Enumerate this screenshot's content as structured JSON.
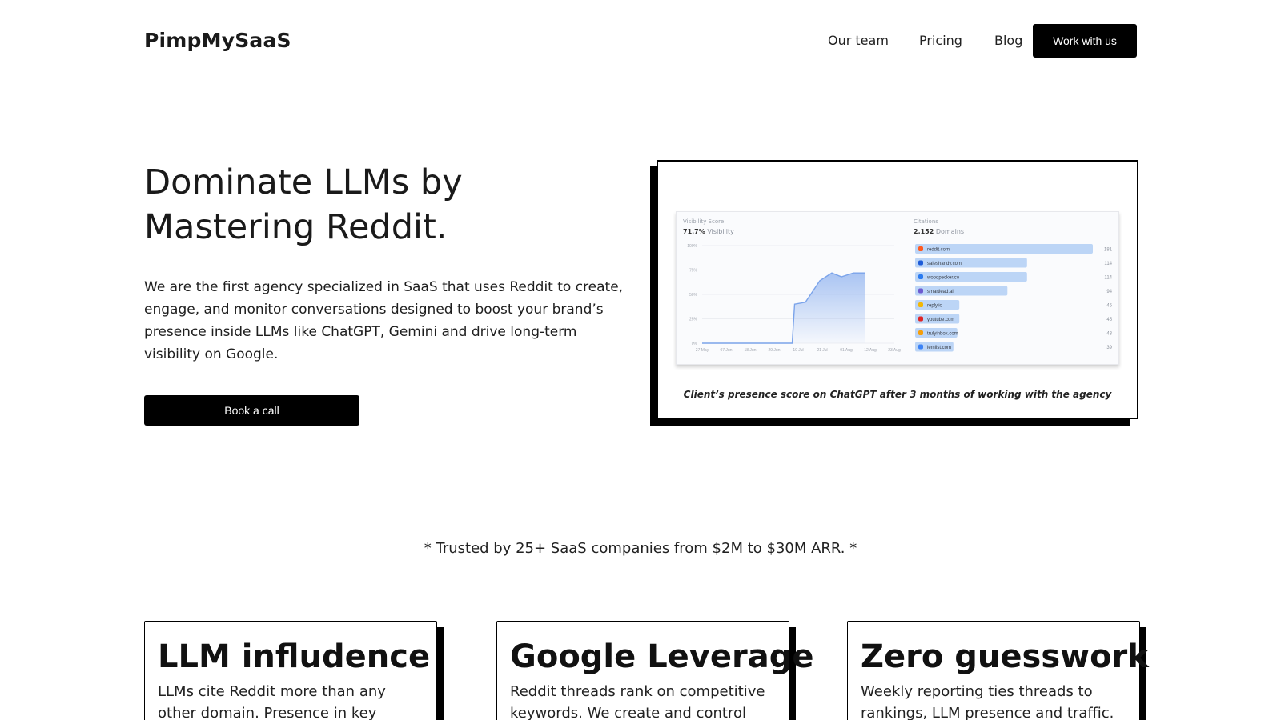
{
  "nav": {
    "brand": "PimpMySaaS",
    "links": [
      "Our team",
      "Pricing",
      "Blog"
    ],
    "cta": "Work with us"
  },
  "hero": {
    "title": "Dominate LLMs by Mastering Reddit.",
    "subtitle": "We are the first agency specialized in SaaS that uses Reddit to create, engage, and monitor conversations designed to boost your brand’s presence inside LLMs like ChatGPT, Gemini and drive long-term visibility on Google.",
    "cta": "Book a call"
  },
  "screenshot": {
    "caption": "Client’s presence score on ChatGPT after 3 months of working with the agency",
    "visibility": {
      "label": "Visibility Score",
      "value": "71.7%",
      "value_suffix": "Visibility"
    },
    "citations": {
      "label": "Citations",
      "value": "2,152",
      "value_suffix": "Domains"
    }
  },
  "chart_data": [
    {
      "type": "area",
      "title": "Visibility Score",
      "x": [
        "27 May",
        "07 Jun",
        "18 Jun",
        "29 Jun",
        "10 Jul",
        "21 Jul",
        "01 Aug",
        "12 Aug",
        "23 Aug"
      ],
      "y_ticks": [
        "0%",
        "25%",
        "50%",
        "75%",
        "100%"
      ],
      "ylim": [
        0,
        100
      ],
      "series": [
        {
          "points": [
            [
              0,
              0
            ],
            [
              1,
              0
            ],
            [
              2,
              0
            ],
            [
              3,
              0
            ],
            [
              3.75,
              0
            ],
            [
              3.85,
              40
            ],
            [
              4.3,
              42
            ],
            [
              4.9,
              64
            ],
            [
              5.4,
              72
            ],
            [
              5.8,
              68
            ],
            [
              6.3,
              72
            ],
            [
              6.8,
              72
            ]
          ]
        }
      ],
      "color": "#8fb2ef"
    },
    {
      "type": "bar",
      "title": "Citations",
      "categories": [
        "reddit.com",
        "saleshandy.com",
        "woodpecker.co",
        "smartlead.ai",
        "reply.io",
        "youtube.com",
        "trulyinbox.com",
        "lemlist.com"
      ],
      "values": [
        181,
        114,
        114,
        94,
        45,
        45,
        43,
        39
      ],
      "xlim": [
        0,
        181
      ],
      "color": "#bcd5f6",
      "icon_colors": [
        "#ff5a1f",
        "#1d5bd8",
        "#2b7bf0",
        "#6d5bd0",
        "#f2b705",
        "#e02424",
        "#f59e0b",
        "#3b82f6"
      ]
    }
  ],
  "trusted": "* Trusted by 25+ SaaS companies from $2M to $30M ARR. *",
  "features": [
    {
      "title": "LLM infludence",
      "text": "LLMs cite Reddit more than any other domain. Presence in key threads"
    },
    {
      "title": "Google Leverage",
      "text": "Reddit threads rank on competitive keywords. We create and control SEO"
    },
    {
      "title": "Zero guesswork",
      "text": "Weekly reporting ties threads to rankings, LLM presence and traffic. You"
    }
  ]
}
